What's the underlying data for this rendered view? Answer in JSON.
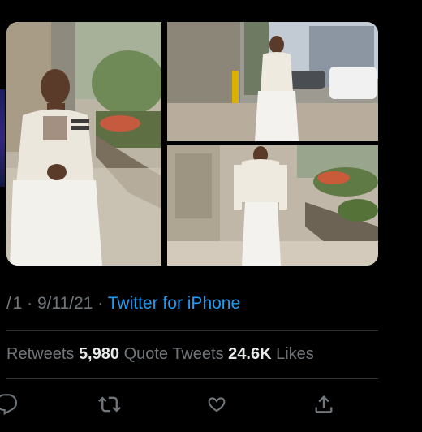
{
  "tweet": {
    "meta": {
      "time_prefix": "/ 1 · ",
      "date": "9/11/21",
      "separator": " · ",
      "source": "Twitter for iPhone"
    },
    "stats": {
      "retweets_label": "Retweets",
      "quote_tweets_count": "5,980",
      "quote_tweets_label": "Quote Tweets",
      "likes_count": "24.6K",
      "likes_label": "Likes"
    },
    "actions": [
      "reply-icon",
      "retweet-icon",
      "like-icon",
      "share-icon"
    ]
  },
  "colors": {
    "background": "#000000",
    "link": "#1d9bf0",
    "muted_text": "#71767b",
    "primary_text": "#e7e9ea",
    "divider": "#2f3336"
  }
}
